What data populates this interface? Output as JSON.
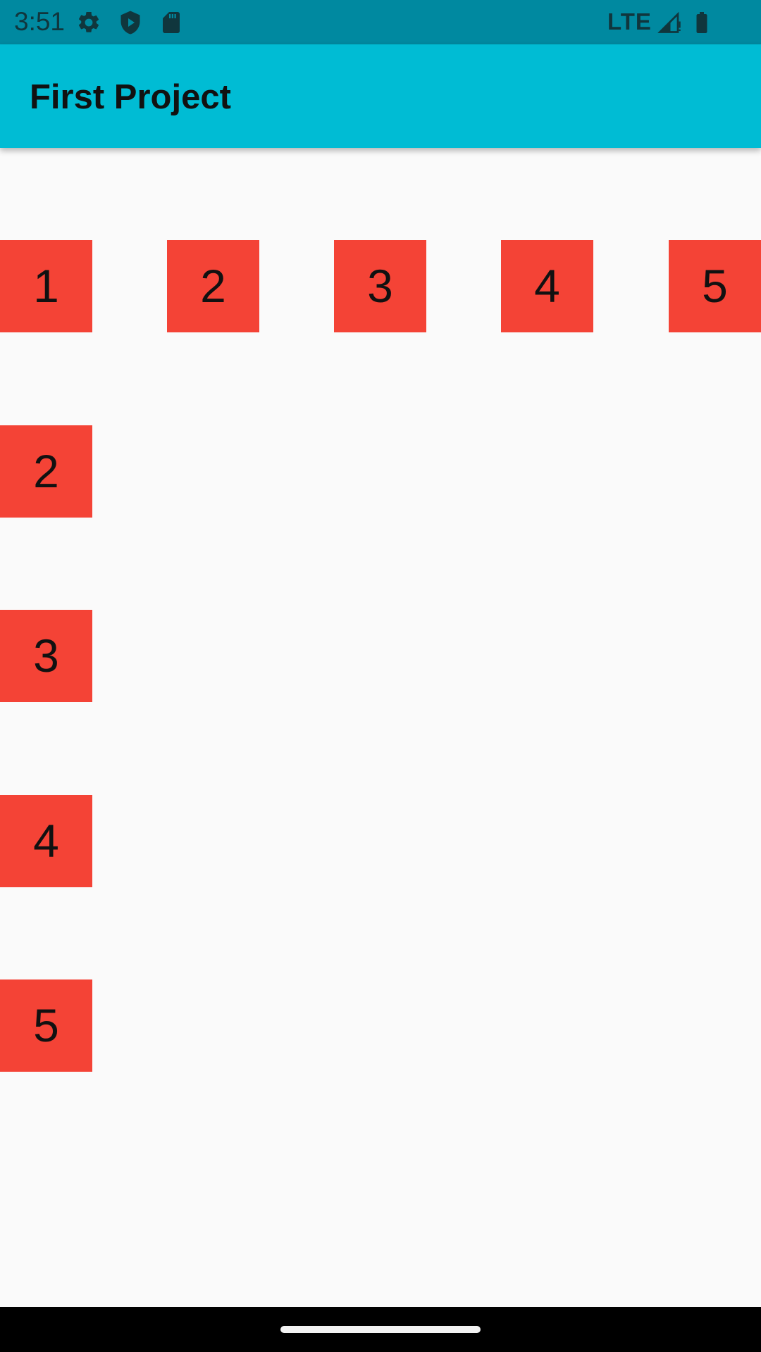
{
  "status_bar": {
    "time": "3:51",
    "network": "LTE",
    "icons": [
      "settings-icon",
      "shield-icon",
      "sd-card-icon",
      "signal-icon",
      "battery-icon"
    ],
    "background_color": "#0089a0"
  },
  "app_bar": {
    "title": "First Project",
    "background_color": "#00bcd4"
  },
  "grid": {
    "top_row": [
      "1",
      "2",
      "3",
      "4",
      "5"
    ],
    "left_column": [
      "2",
      "3",
      "4",
      "5"
    ],
    "cell_color": "#f44336"
  }
}
